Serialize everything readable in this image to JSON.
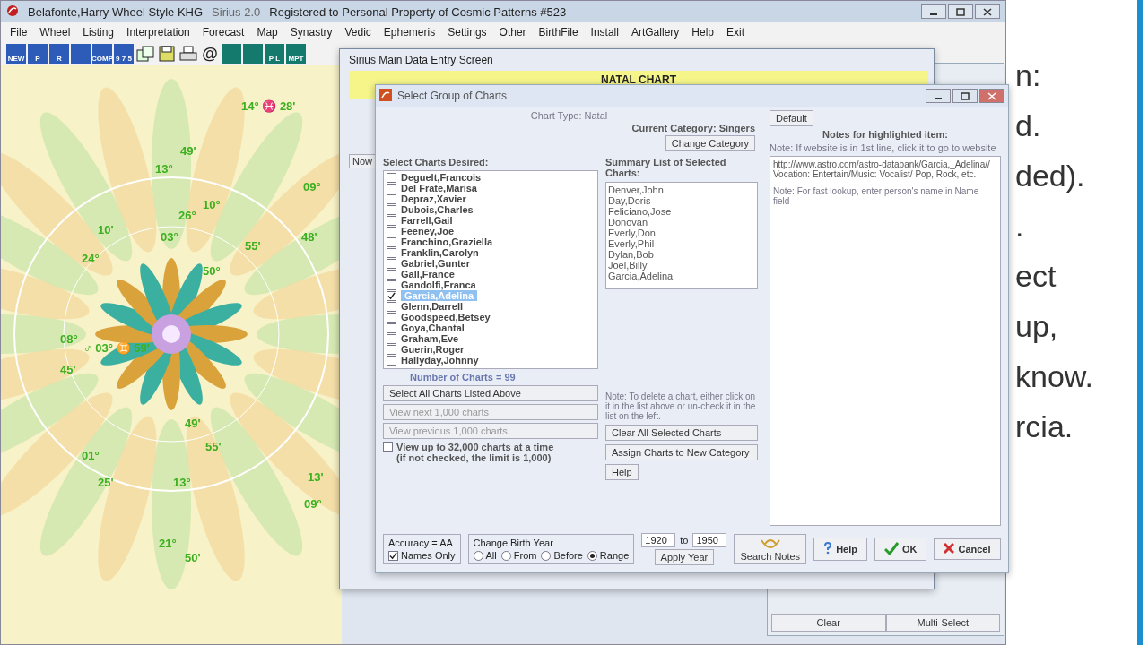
{
  "slide": {
    "fragments": [
      "n:",
      "d.",
      "ded).",
      ".",
      "ect",
      "up,",
      "know.",
      "rcia."
    ]
  },
  "app": {
    "title_parts": [
      "Belafonte,Harry Wheel Style KHG",
      "Sirius 2.0",
      "Registered to Personal Property of Cosmic Patterns #523"
    ],
    "menu": [
      "File",
      "Wheel",
      "Listing",
      "Interpretation",
      "Forecast",
      "Map",
      "Synastry",
      "Vedic",
      "Ephemeris",
      "Settings",
      "Other",
      "BirthFile",
      "Install",
      "ArtGallery",
      "Help",
      "Exit"
    ],
    "toolbar": [
      {
        "kind": "wheel",
        "label": "NEW"
      },
      {
        "kind": "wheel",
        "label": "P"
      },
      {
        "kind": "wheel",
        "label": "R"
      },
      {
        "kind": "wheel"
      },
      {
        "kind": "wheel",
        "label": "COMP"
      },
      {
        "kind": "wheel",
        "label": "9 7 5"
      },
      {
        "kind": "windows"
      },
      {
        "kind": "disk"
      },
      {
        "kind": "printer"
      },
      {
        "kind": "glyph",
        "label": "@"
      },
      {
        "kind": "green"
      },
      {
        "kind": "green"
      },
      {
        "kind": "green",
        "label": "P L"
      },
      {
        "kind": "green",
        "label": "MPT"
      }
    ],
    "wheel_labels": [
      "14° ♓ 28'",
      "49'",
      "13°",
      "10°",
      "26°",
      "09°",
      "10'",
      "03°",
      "55'",
      "24°",
      "50°",
      "48'",
      "08°",
      "♂ 03° ♊ 59'",
      "45'",
      "49'",
      "55'",
      "01°",
      "25'",
      "13°",
      "13'",
      "09°",
      "21°",
      "50'"
    ]
  },
  "side_window": {
    "buttons": [
      "Clear",
      "Multi-Select"
    ]
  },
  "main_dialog": {
    "title": "Sirius Main Data Entry Screen",
    "header": "NATAL CHART",
    "now": "Now"
  },
  "group_dialog": {
    "title": "Select Group of Charts",
    "chart_type": "Chart Type: Natal",
    "category": "Current Category: Singers",
    "change_category": "Change Category",
    "default_button": "Default",
    "notes_label": "Notes for highlighted item:",
    "notes_hint": "Note: If website is in 1st line, click it to go to website",
    "item_notes": "http://www.astro.com/astro-databank/Garcia,_Adelina// Vocation: Entertain/Music: Vocalist/ Pop, Rock, etc.",
    "lookup_hint": "Note: For fast lookup, enter person's name in Name field",
    "desired_label": "Select Charts Desired:",
    "charts": [
      {
        "name": "Deguelt,Francois",
        "selected": false
      },
      {
        "name": "Del Frate,Marisa",
        "selected": false
      },
      {
        "name": "Depraz,Xavier",
        "selected": false
      },
      {
        "name": "Dubois,Charles",
        "selected": false
      },
      {
        "name": "Farrell,Gail",
        "selected": false
      },
      {
        "name": "Feeney,Joe",
        "selected": false
      },
      {
        "name": "Franchino,Graziella",
        "selected": false
      },
      {
        "name": "Franklin,Carolyn",
        "selected": false
      },
      {
        "name": "Gabriel,Gunter",
        "selected": false
      },
      {
        "name": "Gall,France",
        "selected": false
      },
      {
        "name": "Gandolfi,Franca",
        "selected": false
      },
      {
        "name": "Garcia,Adelina",
        "selected": true
      },
      {
        "name": "Glenn,Darrell",
        "selected": false
      },
      {
        "name": "Goodspeed,Betsey",
        "selected": false
      },
      {
        "name": "Goya,Chantal",
        "selected": false
      },
      {
        "name": "Graham,Eve",
        "selected": false
      },
      {
        "name": "Guerin,Roger",
        "selected": false
      },
      {
        "name": "Hallyday,Johnny",
        "selected": false
      }
    ],
    "count": "Number of Charts = 99",
    "select_all": "Select All Charts Listed Above",
    "view_next": "View next 1,000 charts",
    "view_prev": "View previous 1,000 charts",
    "view_up": {
      "label": "View up to 32,000 charts at a time",
      "note": "(if not checked, the limit is 1,000)",
      "checked": false
    },
    "summary_label": "Summary List of Selected Charts:",
    "summary": [
      "Denver,John",
      "Day,Doris",
      "Feliciano,Jose",
      "Donovan",
      "Everly,Don",
      "Everly,Phil",
      "Dylan,Bob",
      "Joel,Billy",
      "Garcia,Adelina"
    ],
    "delete_note": "Note: To delete a chart, either click on it in the list above or un-check it in the list on the left.",
    "clear_all": "Clear All Selected Charts",
    "assign": "Assign Charts to New Category",
    "help": "Help",
    "accuracy": "Accuracy = AA",
    "names_only": {
      "label": "Names Only",
      "checked": true
    },
    "birth_year": "Change Birth Year",
    "year_options": [
      {
        "label": "All",
        "selected": false
      },
      {
        "label": "From",
        "selected": false
      },
      {
        "label": "Before",
        "selected": false
      },
      {
        "label": "Range",
        "selected": true
      }
    ],
    "year_from": "1920",
    "to": "to",
    "year_to": "1950",
    "apply_year": "Apply Year",
    "search_notes": "Search Notes",
    "buttons": [
      {
        "kind": "help",
        "label": "Help"
      },
      {
        "kind": "check",
        "label": "OK"
      },
      {
        "kind": "cross",
        "label": "Cancel"
      }
    ]
  }
}
